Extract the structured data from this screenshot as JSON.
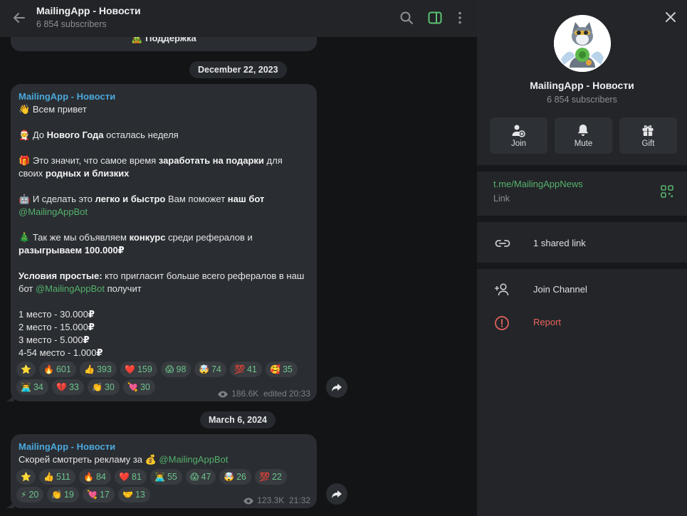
{
  "header": {
    "title": "MailingApp - Новости",
    "subscribers": "6 854 subscribers"
  },
  "pinned_fragment": {
    "emoji": "🧟",
    "text": "Поддержка"
  },
  "date_separators": [
    "December 22, 2023",
    "March 6, 2024"
  ],
  "messages": [
    {
      "channel": "MailingApp - Новости",
      "lines": [
        {
          "e": "👋",
          "parts": [
            {
              "t": "Всем привет"
            }
          ]
        },
        {
          "parts": []
        },
        {
          "e": "🧑‍🎄",
          "parts": [
            {
              "t": "До "
            },
            {
              "t": "Нового Года",
              "b": true
            },
            {
              "t": " осталась неделя"
            }
          ]
        },
        {
          "parts": []
        },
        {
          "e": "🎁",
          "parts": [
            {
              "t": "Это значит, что самое время "
            },
            {
              "t": "заработать на подарки",
              "b": true
            },
            {
              "t": " для"
            }
          ]
        },
        {
          "parts": [
            {
              "t": "своих "
            },
            {
              "t": "родных и близких",
              "b": true
            }
          ]
        },
        {
          "parts": []
        },
        {
          "e": "🤖",
          "parts": [
            {
              "t": "И сделать это "
            },
            {
              "t": "легко и быстро",
              "b": true
            },
            {
              "t": " Вам поможет "
            },
            {
              "t": "наш бот",
              "b": true
            }
          ]
        },
        {
          "parts": [
            {
              "t": "@MailingAppBot",
              "link": true
            }
          ]
        },
        {
          "parts": []
        },
        {
          "e": "🎄",
          "parts": [
            {
              "t": "Так же мы объявляем "
            },
            {
              "t": "конкурс",
              "b": true
            },
            {
              "t": " среди рефералов и"
            }
          ]
        },
        {
          "parts": [
            {
              "t": "разыгрываем 100.000₽",
              "b": true
            }
          ]
        },
        {
          "parts": []
        },
        {
          "parts": [
            {
              "t": "Условия простые:",
              "b": true
            },
            {
              "t": " кто пригласит больше всего рефералов в наш"
            }
          ]
        },
        {
          "parts": [
            {
              "t": "бот "
            },
            {
              "t": "@MailingAppBot",
              "link": true
            },
            {
              "t": " получит"
            }
          ]
        },
        {
          "parts": []
        },
        {
          "parts": [
            {
              "t": "1 место - 30.000"
            },
            {
              "t": "₽",
              "b": true
            }
          ]
        },
        {
          "parts": [
            {
              "t": "2 место - 15.000"
            },
            {
              "t": "₽",
              "b": true
            }
          ]
        },
        {
          "parts": [
            {
              "t": "3 место - 5.000"
            },
            {
              "t": "₽",
              "b": true
            }
          ]
        },
        {
          "parts": [
            {
              "t": "4-54 место - 1.000"
            },
            {
              "t": "₽",
              "b": true
            }
          ]
        }
      ],
      "reactions": [
        [
          {
            "e": "⭐",
            "n": ""
          },
          {
            "e": "🔥",
            "n": "601"
          },
          {
            "e": "👍",
            "n": "393"
          },
          {
            "e": "❤️",
            "n": "159"
          },
          {
            "e": "😱",
            "n": "98"
          },
          {
            "e": "🤯",
            "n": "74"
          },
          {
            "e": "💯",
            "n": "41"
          },
          {
            "e": "🥰",
            "n": "35"
          }
        ],
        [
          {
            "e": "👨‍💻",
            "n": "34"
          },
          {
            "e": "💔",
            "n": "33"
          },
          {
            "e": "👏",
            "n": "30"
          },
          {
            "e": "💘",
            "n": "30"
          }
        ]
      ],
      "views": "186.6K",
      "time": "edited 20:33"
    },
    {
      "channel": "MailingApp - Новости",
      "lines": [
        {
          "parts": [
            {
              "t": "Скорей смотреть рекламу за "
            },
            {
              "t": "💰 "
            },
            {
              "t": "@MailingAppBot",
              "link": true
            }
          ]
        }
      ],
      "reactions": [
        [
          {
            "e": "⭐",
            "n": ""
          },
          {
            "e": "👍",
            "n": "511"
          },
          {
            "e": "🔥",
            "n": "84"
          },
          {
            "e": "❤️",
            "n": "81"
          },
          {
            "e": "👨‍💻",
            "n": "55"
          },
          {
            "e": "😱",
            "n": "47"
          },
          {
            "e": "🤯",
            "n": "26"
          },
          {
            "e": "💯",
            "n": "22"
          }
        ],
        [
          {
            "e": "⚡",
            "n": "20"
          },
          {
            "e": "👏",
            "n": "19"
          },
          {
            "e": "💘",
            "n": "17"
          },
          {
            "e": "🤝",
            "n": "13"
          }
        ]
      ],
      "views": "123.3K",
      "time": "21:32"
    }
  ],
  "side": {
    "title": "MailingApp - Новости",
    "subscribers": "6 854 subscribers",
    "actions": [
      {
        "label": "Join",
        "icon": "add-user-icon"
      },
      {
        "label": "Mute",
        "icon": "bell-icon"
      },
      {
        "label": "Gift",
        "icon": "gift-icon"
      }
    ],
    "link": "t.me/MailingAppNews",
    "link_label": "Link",
    "shared_links": "1 shared link",
    "join_channel": "Join Channel",
    "report": "Report"
  },
  "colors": {
    "accent_blue": "#4ba8dc",
    "link_green": "#58b36d",
    "reaction_count": "#6dc48c",
    "danger": "#e9645d"
  }
}
